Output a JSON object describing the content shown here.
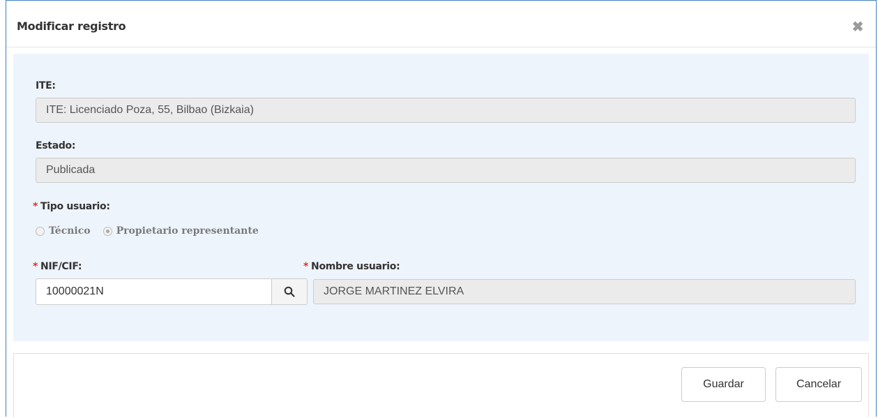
{
  "dialog": {
    "title": "Modificar registro",
    "close_icon": "close-icon"
  },
  "form": {
    "ite": {
      "label": "ITE:",
      "value": "ITE: Licenciado Poza, 55, Bilbao (Bizkaia)"
    },
    "estado": {
      "label": "Estado:",
      "value": "Publicada"
    },
    "tipo_usuario": {
      "required_mark": "*",
      "label": "Tipo usuario:",
      "options": [
        {
          "label": "Técnico",
          "checked": false
        },
        {
          "label": "Propietario representante",
          "checked": true
        }
      ]
    },
    "nif": {
      "required_mark": "*",
      "label": "NIF/CIF:",
      "value": "10000021N",
      "search_icon": "search-icon"
    },
    "nombre_usuario": {
      "required_mark": "*",
      "label": "Nombre usuario:",
      "value": "JORGE MARTINEZ ELVIRA"
    }
  },
  "footer": {
    "save_label": "Guardar",
    "cancel_label": "Cancelar"
  },
  "colors": {
    "border_accent": "#3e7fc1",
    "body_bg": "#eef4fb",
    "required": "#d9342b",
    "readonly_bg": "#ebebeb"
  }
}
